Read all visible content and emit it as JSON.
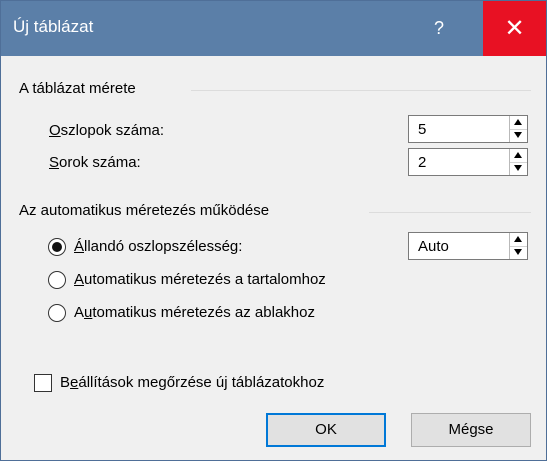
{
  "window": {
    "title": "Új táblázat",
    "help_label": "?",
    "close_label": "✕"
  },
  "table_size": {
    "group_title": "A táblázat mérete",
    "columns": {
      "label_accel": "O",
      "label_rest": "szlopok száma:",
      "value": "5"
    },
    "rows": {
      "label_accel": "S",
      "label_rest": "orok száma:",
      "value": "2"
    }
  },
  "autofit": {
    "group_title": "Az automatikus méretezés működése",
    "fixed": {
      "label_accel": "Á",
      "label_rest": "llandó oszlopszélesség:",
      "selected": true,
      "value": "Auto"
    },
    "contents": {
      "label_accel": "A",
      "label_rest": "utomatikus méretezés a tartalomhoz",
      "selected": false
    },
    "window": {
      "label_pre": "A",
      "label_accel": "u",
      "label_rest": "tomatikus méretezés az ablakhoz",
      "selected": false
    }
  },
  "remember": {
    "label_pre": "B",
    "label_accel": "e",
    "label_rest": "állítások megőrzése új táblázatokhoz",
    "checked": false
  },
  "buttons": {
    "ok": "OK",
    "cancel": "Mégse"
  },
  "colors": {
    "titlebar": "#5b7fa8",
    "close": "#e81123",
    "default_border": "#0078d7"
  }
}
